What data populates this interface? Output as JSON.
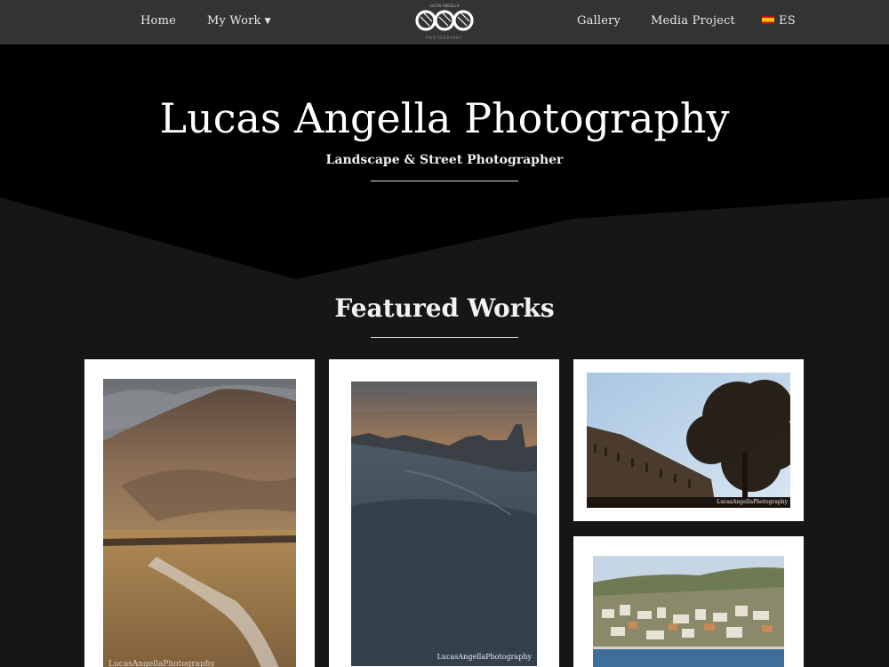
{
  "nav": {
    "home": "Home",
    "my_work": "My Work",
    "gallery": "Gallery",
    "media_project": "Media Project",
    "language": "ES",
    "language_flag_icon": "spain-flag-icon",
    "my_work_icon": "chevron-down-icon",
    "logo": {
      "top_text": "LUCAS ANGELLA",
      "bottom_text": "PHOTOGRAPHY",
      "icon": "camera-lens-rings-logo"
    }
  },
  "hero": {
    "title": "Lucas Angella Photography",
    "subtitle": "Landscape & Street Photographer"
  },
  "featured": {
    "title": "Featured Works",
    "works": [
      {
        "subject": "mountain-river-landscape",
        "watermark": "LucasAngellaPhotography"
      },
      {
        "subject": "snow-dunes-sunset",
        "watermark": "LucasAngellaPhotography"
      },
      {
        "subject": "crescent-building-tree",
        "watermark": "LucasAngellaPhotography"
      },
      {
        "subject": "coastal-town-seafront",
        "watermark": ""
      }
    ]
  },
  "colors": {
    "nav_bg": "#333333",
    "hero_bg": "#000000",
    "page_bg": "#161616",
    "card_bg": "#ffffff",
    "text": "#ffffff"
  }
}
